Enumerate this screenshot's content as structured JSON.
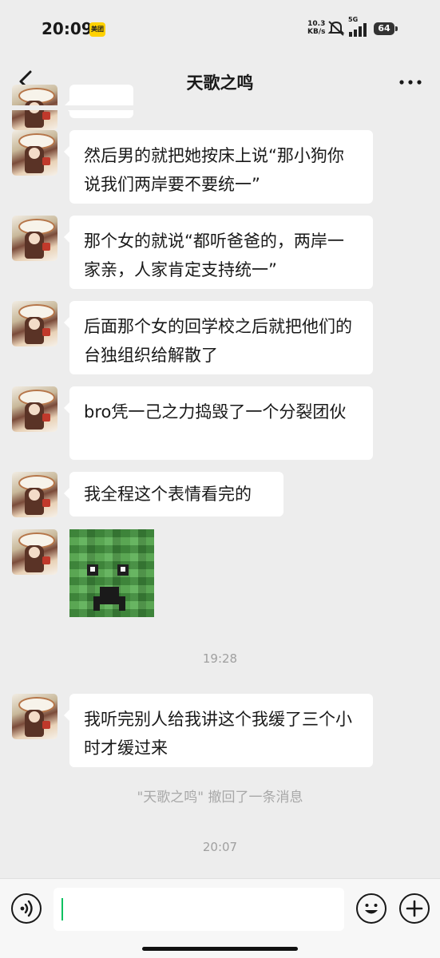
{
  "status_bar": {
    "time": "20:09",
    "app_badge": "美团",
    "net_speed_value": "10.3",
    "net_speed_unit": "KB/s",
    "signal_label": "5G",
    "battery": "64"
  },
  "nav": {
    "title": "天歌之鸣",
    "back_icon": "chevron-left-icon",
    "more_icon": "more-dots-icon"
  },
  "messages": [
    {
      "type": "text",
      "text": "然后男的就把她按床上说“那小狗你说我们两岸要不要统一”"
    },
    {
      "type": "text",
      "text": "那个女的就说“都听爸爸的，两岸一家亲，人家肯定支持统一”"
    },
    {
      "type": "text",
      "text": "后面那个女的回学校之后就把他们的台独组织给解散了"
    },
    {
      "type": "text",
      "text": "bro凭一己之力捣毁了一个分裂团伙"
    },
    {
      "type": "text",
      "text": "我全程这个表情看完的"
    },
    {
      "type": "sticker",
      "text": ""
    },
    {
      "type": "timestamp",
      "text": "19:28"
    },
    {
      "type": "text",
      "text": "我听完别人给我讲这个我缓了三个小时才缓过来"
    },
    {
      "type": "recall",
      "text": "\"天歌之鸣\" 撤回了一条消息"
    },
    {
      "type": "timestamp",
      "text": "20:07"
    }
  ],
  "input_bar": {
    "voice_icon": "voice-icon",
    "emoji_icon": "emoji-icon",
    "plus_icon": "plus-icon",
    "input_value": ""
  },
  "colors": {
    "background": "#ededed",
    "bubble": "#ffffff",
    "caret": "#07c160",
    "system_text": "#a8a8a8"
  }
}
